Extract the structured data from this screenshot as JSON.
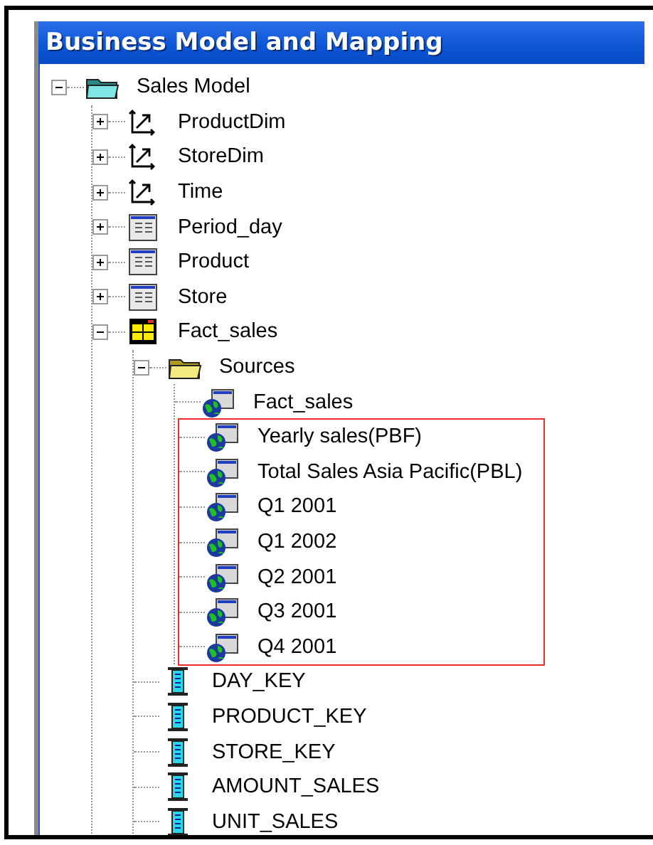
{
  "panel": {
    "title": "Business Model and Mapping"
  },
  "tree": [
    {
      "label": "Sales Model",
      "kind": "business-model",
      "expanded": true,
      "children": [
        {
          "label": "ProductDim",
          "kind": "dimension",
          "expanded": false
        },
        {
          "label": "StoreDim",
          "kind": "dimension",
          "expanded": false
        },
        {
          "label": "Time",
          "kind": "dimension",
          "expanded": false
        },
        {
          "label": "Period_day",
          "kind": "logical-table",
          "expanded": false
        },
        {
          "label": "Product",
          "kind": "logical-table",
          "expanded": false
        },
        {
          "label": "Store",
          "kind": "logical-table",
          "expanded": false
        },
        {
          "label": "Fact_sales",
          "kind": "fact-table",
          "expanded": true,
          "children": [
            {
              "label": "Sources",
              "kind": "folder",
              "expanded": true,
              "children": [
                {
                  "label": "Fact_sales",
                  "kind": "source"
                },
                {
                  "kind": "highlight-group",
                  "highlighted": true,
                  "children": [
                    {
                      "label": "Yearly sales(PBF)",
                      "kind": "source"
                    },
                    {
                      "label": "Total Sales Asia Pacific(PBL)",
                      "kind": "source"
                    },
                    {
                      "label": "Q1 2001",
                      "kind": "source"
                    },
                    {
                      "label": "Q1 2002",
                      "kind": "source"
                    },
                    {
                      "label": "Q2 2001",
                      "kind": "source"
                    },
                    {
                      "label": "Q3 2001",
                      "kind": "source"
                    },
                    {
                      "label": "Q4 2001",
                      "kind": "source"
                    }
                  ]
                }
              ]
            },
            {
              "label": "DAY_KEY",
              "kind": "column"
            },
            {
              "label": "PRODUCT_KEY",
              "kind": "column"
            },
            {
              "label": "STORE_KEY",
              "kind": "column"
            },
            {
              "label": "AMOUNT_SALES",
              "kind": "column"
            },
            {
              "label": "UNIT_SALES",
              "kind": "column"
            }
          ]
        }
      ]
    }
  ]
}
